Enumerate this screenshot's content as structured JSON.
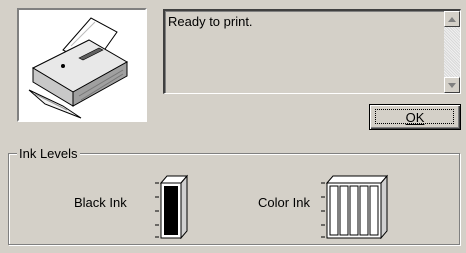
{
  "status": {
    "message": "Ready to print."
  },
  "buttons": {
    "ok_label": "OK"
  },
  "ink_levels": {
    "group_title": "Ink Levels",
    "black": {
      "label": "Black Ink",
      "level": 1.0,
      "colors": [
        "#000000"
      ]
    },
    "color": {
      "label": "Color Ink",
      "level": 1.0,
      "colors": [
        "#ffffff",
        "#ffffff",
        "#ffffff",
        "#ffffff",
        "#ffffff"
      ]
    }
  },
  "icons": {
    "printer": "printer-icon",
    "scroll_up": "scroll-up-arrow-icon",
    "scroll_down": "scroll-down-arrow-icon"
  }
}
